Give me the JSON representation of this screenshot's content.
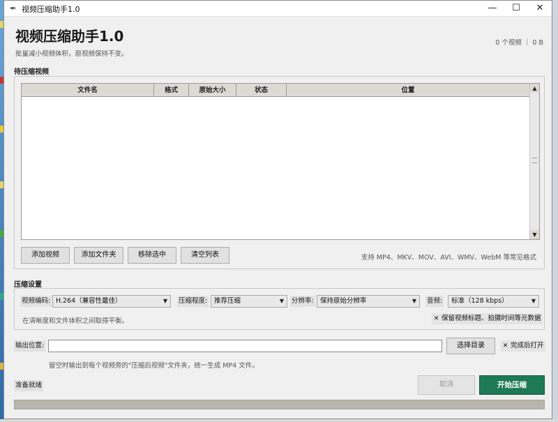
{
  "window": {
    "title": "视频压缩助手1.0",
    "controls": {
      "minimize": "—",
      "maximize": "☐",
      "close": "✕"
    }
  },
  "header": {
    "app_title": "视频压缩助手1.0",
    "subtitle": "批量减小视频体积，原视频保持不变。",
    "count_text": "0 个视频 ｜ 0 B"
  },
  "queue": {
    "section_label": "待压缩视频",
    "columns": [
      "文件名",
      "格式",
      "原始大小",
      "状态",
      "位置"
    ],
    "rows": [],
    "buttons": {
      "add_video": "添加视频",
      "add_folder": "添加文件夹",
      "remove_selected": "移除选中",
      "clear_list": "清空列表"
    },
    "formats_hint": "支持 MP4、MKV、MOV、AVI、WMV、WebM 等常见格式"
  },
  "settings": {
    "section_label": "压缩设置",
    "codec_label": "视频编码:",
    "codec_value": "H.264（兼容性最佳）",
    "level_label": "压缩程度:",
    "level_value": "推荐压缩",
    "resolution_label": "分辨率:",
    "resolution_value": "保持原始分辨率",
    "audio_label": "音频:",
    "audio_value": "标准（128 kbps）",
    "balance_hint": "在清晰度和文件体积之间取得平衡。",
    "keep_metadata": {
      "checked": true,
      "label": "保留视频标题、拍摄时间等元数据"
    }
  },
  "output": {
    "label": "输出位置:",
    "path_value": "",
    "choose_dir": "选择目录",
    "open_after": {
      "checked": true,
      "label": "完成后打开"
    },
    "hint": "留空时输出到每个视频旁的\"压缩后视频\"文件夹，统一生成 MP4 文件。"
  },
  "footer": {
    "status": "准备就绪",
    "cancel": "取消",
    "start": "开始压缩",
    "progress": 0
  },
  "colors": {
    "accent": "#1e7a56",
    "progress_track": "#b9b5ac"
  }
}
